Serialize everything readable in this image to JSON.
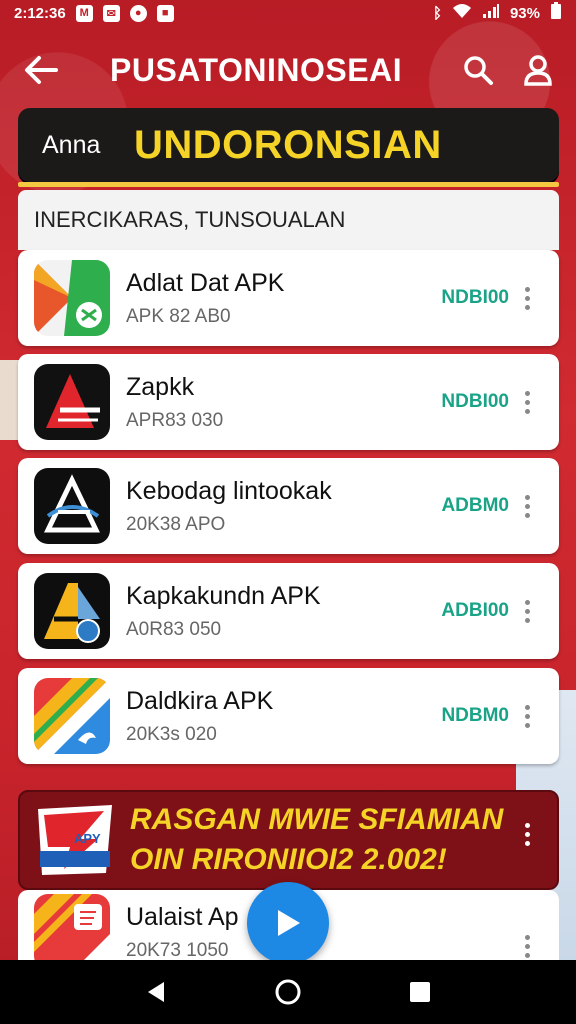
{
  "status_bar": {
    "time": "2:12:36",
    "icons_left": [
      "m-icon",
      "mail-icon",
      "circle-icon",
      "shop-icon"
    ],
    "battery": "93%"
  },
  "app_bar": {
    "title": "PUSATONINOSEAI"
  },
  "banner": {
    "prefix": "Anna",
    "title": "UNDORONSIAN"
  },
  "section": {
    "header": "INERCIKARAS, TUNSOUALAN"
  },
  "apps": [
    {
      "name": "Adlat Dat APK",
      "meta": "APK 82 AB0",
      "badge": "NDBI00"
    },
    {
      "name": "Zapkk",
      "meta": "APR83 030",
      "badge": "NDBI00"
    },
    {
      "name": "Kebodag lintookak",
      "meta": "20K38 APO",
      "badge": "ADBM0"
    },
    {
      "name": "Kapkakundn APK",
      "meta": "A0R83 050",
      "badge": "ADBI00"
    },
    {
      "name": "Daldkira APK",
      "meta": "20K3s 020",
      "badge": "NDBM0"
    }
  ],
  "promo": {
    "line1": "RASGAN MWIE SFIAMIAN",
    "line2": "OIN RIRONIIOI2 2.002!",
    "logo_text": "APY"
  },
  "bottom_app": {
    "name": "Ualaist Ap",
    "meta": "20K73 1050"
  },
  "colors": {
    "brand_red": "#c4202a",
    "accent_yellow": "#f5d327",
    "badge_green": "#1aa387",
    "fab_blue": "#1e88e5"
  }
}
